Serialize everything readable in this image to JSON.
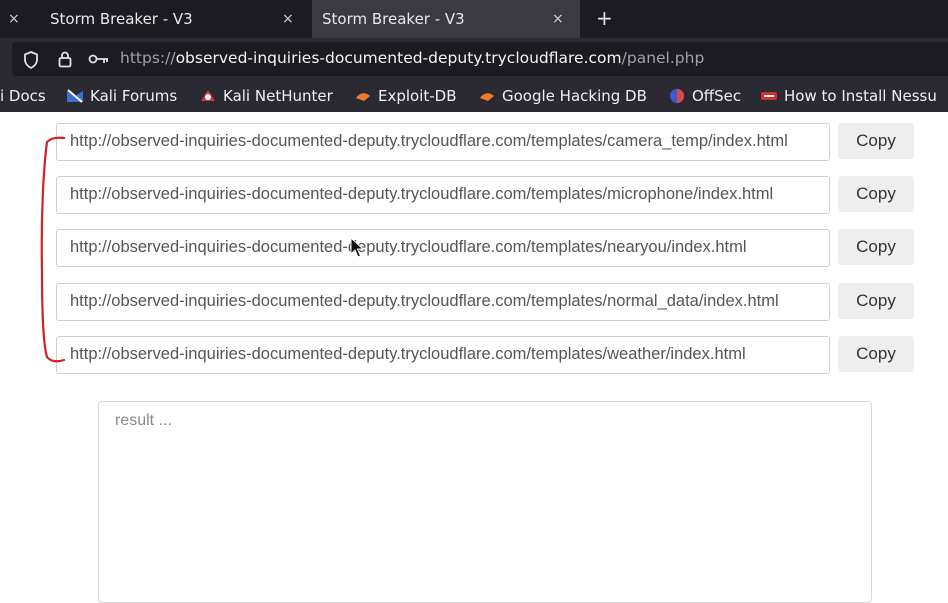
{
  "tabs": [
    {
      "title": "Storm Breaker - V3",
      "active": false
    },
    {
      "title": "Storm Breaker - V3",
      "active": true
    }
  ],
  "new_tab_label": "+",
  "close_glyph": "×",
  "address": {
    "scheme": "https://",
    "host": "observed-inquiries-documented-deputy.trycloudflare.com",
    "path": "/panel.php"
  },
  "bookmarks": [
    {
      "label": "i Docs",
      "icon": "kali-docs-icon"
    },
    {
      "label": "Kali Forums",
      "icon": "kali-forums-icon"
    },
    {
      "label": "Kali NetHunter",
      "icon": "nethunter-icon"
    },
    {
      "label": "Exploit-DB",
      "icon": "exploit-db-icon"
    },
    {
      "label": "Google Hacking DB",
      "icon": "ghdb-icon"
    },
    {
      "label": "OffSec",
      "icon": "offsec-icon"
    },
    {
      "label": "How to Install Nessu",
      "icon": "nessus-icon"
    }
  ],
  "links": [
    {
      "url": "http://observed-inquiries-documented-deputy.trycloudflare.com/templates/camera_temp/index.html",
      "button": "Copy"
    },
    {
      "url": "http://observed-inquiries-documented-deputy.trycloudflare.com/templates/microphone/index.html",
      "button": "Copy"
    },
    {
      "url": "http://observed-inquiries-documented-deputy.trycloudflare.com/templates/nearyou/index.html",
      "button": "Copy"
    },
    {
      "url": "http://observed-inquiries-documented-deputy.trycloudflare.com/templates/normal_data/index.html",
      "button": "Copy"
    },
    {
      "url": "http://observed-inquiries-documented-deputy.trycloudflare.com/templates/weather/index.html",
      "button": "Copy"
    }
  ],
  "result_placeholder": "result ...",
  "colors": {
    "annotation": "#d0202a",
    "tab_bg": "#1c1b22",
    "active_tab": "#3b3a43",
    "toolbar": "#2b2a33"
  }
}
